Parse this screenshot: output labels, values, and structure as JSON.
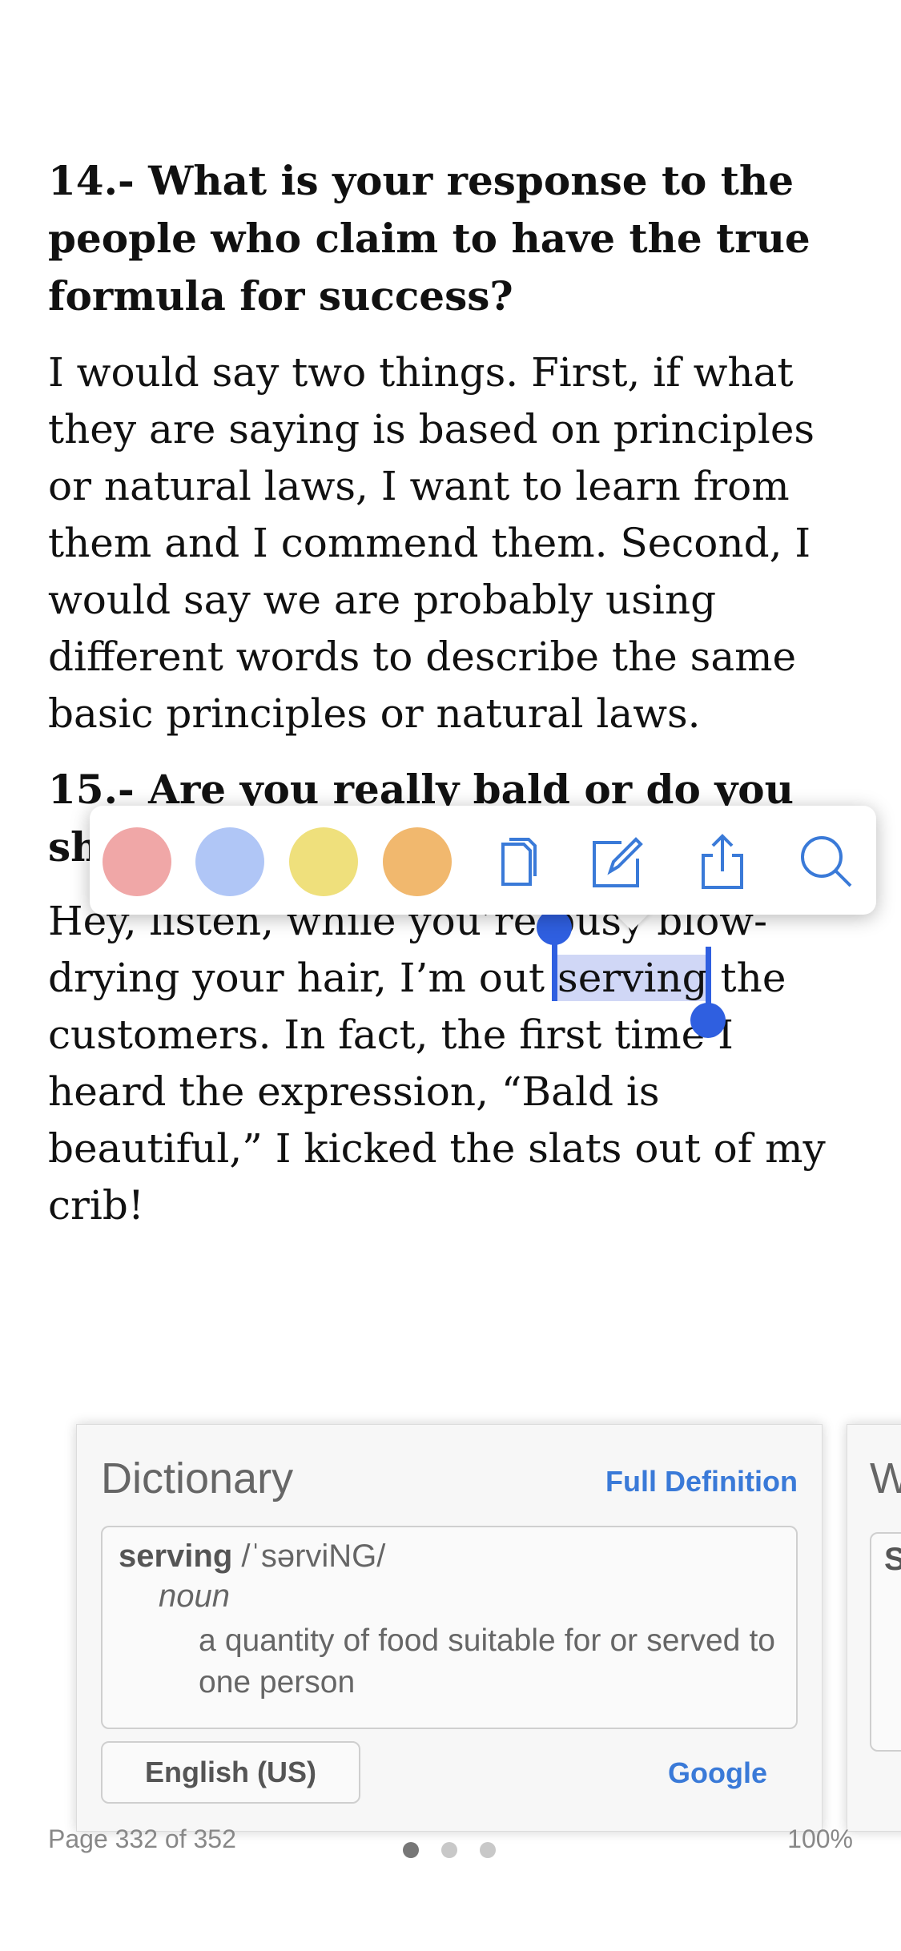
{
  "reader": {
    "q14": "14.- What is your response to the people who claim to have the true formula for success?",
    "a14": "I would say two things. First, if what they are saying is based on principles or natural laws, I want to learn from them and I commend them. Second, I would say we are probably using different words to describe the same basic principles or natural laws.",
    "q15": "15.- Are you really bald or do you sh",
    "a15_before": "Hey, listen, while you’re busy blow-drying your hair, I’m out ",
    "a15_selected": "serving",
    "a15_after": " the customers. In fact, the first time I heard the expression, “Bald is beautiful,” I kicked the slats out of my crib!"
  },
  "popup": {
    "colors": [
      "#f0a7a7",
      "#b0c6f6",
      "#efe07c",
      "#f1b86e"
    ],
    "tools": [
      "copy-icon",
      "note-icon",
      "share-icon",
      "search-icon"
    ],
    "accent": "#3a7ad8"
  },
  "dictionary": {
    "title": "Dictionary",
    "full_definition": "Full Definition",
    "word": "serving",
    "pronunciation": " /ˈsərviNG/",
    "part_of_speech": "noun",
    "definition": "a quantity of food suitable for or served to one person",
    "language": "English (US)",
    "google": "Google"
  },
  "next_card": {
    "title_fragment": "W",
    "box_fragment": "S"
  },
  "footer": {
    "page": "Page 332 of 352",
    "percent": "100%",
    "page_dots": 3,
    "active_dot": 0
  }
}
